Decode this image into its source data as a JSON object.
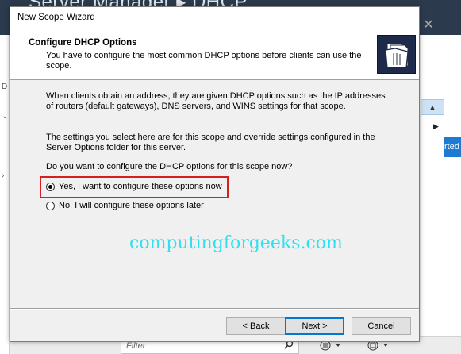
{
  "background": {
    "title": "Server Manager ▸ DHCP",
    "close_glyph": "✕",
    "left_glyphs": [
      "D",
      "⌄",
      "›"
    ],
    "right_button_label": "rted",
    "filter_placeholder": "Filter",
    "icons": [
      "search-icon",
      "list-options-icon",
      "save-icon"
    ]
  },
  "dialog": {
    "title": "New Scope Wizard",
    "header": {
      "title": "Configure DHCP Options",
      "subtitle": "You have to configure the most common DHCP options before clients can use the scope.",
      "icon": "folder-open-icon"
    },
    "paragraph1": "When clients obtain an address, they are given DHCP options such as the IP addresses of routers (default gateways), DNS servers, and WINS settings for that scope.",
    "paragraph2": "The settings you select here are for this scope and override settings configured in the Server Options folder for this server.",
    "question": "Do you want to configure the DHCP options for this scope now?",
    "options": [
      {
        "label": "Yes, I want to configure these options now",
        "checked": true
      },
      {
        "label": "No, I will configure these options later",
        "checked": false
      }
    ],
    "watermark": "computingforgeeks.com",
    "buttons": {
      "back": "< Back",
      "next": "Next >",
      "cancel": "Cancel"
    }
  },
  "colors": {
    "highlight_box": "#d62020",
    "watermark": "#2fe0f0",
    "accent": "#0078d7"
  }
}
